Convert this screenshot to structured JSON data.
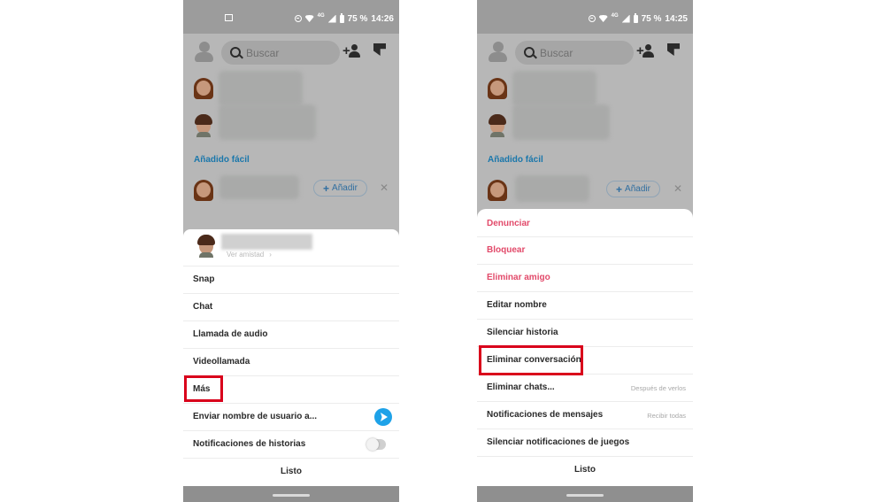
{
  "screens": [
    {
      "status_time": "14:26",
      "battery": "75 %",
      "network": "4G",
      "search_placeholder": "Buscar",
      "quick_add_title": "Añadido fácil",
      "quick_add_button": "Añadir",
      "sheet": {
        "ver_amistad": "Ver amistad",
        "items": [
          {
            "label": "Snap"
          },
          {
            "label": "Chat"
          },
          {
            "label": "Llamada de audio"
          },
          {
            "label": "Videollamada"
          },
          {
            "label": "Más"
          },
          {
            "label": "Enviar nombre de usuario a..."
          },
          {
            "label": "Notificaciones de historias"
          }
        ],
        "done": "Listo",
        "highlighted": "Más"
      }
    },
    {
      "status_time": "14:25",
      "battery": "75 %",
      "network": "4G",
      "search_placeholder": "Buscar",
      "quick_add_title": "Añadido fácil",
      "quick_add_button": "Añadir",
      "sheet": {
        "items": [
          {
            "label": "Denunciar",
            "color": "#e24a6a"
          },
          {
            "label": "Bloquear",
            "color": "#e24a6a"
          },
          {
            "label": "Eliminar amigo",
            "color": "#e24a6a"
          },
          {
            "label": "Editar nombre"
          },
          {
            "label": "Silenciar historia"
          },
          {
            "label": "Eliminar conversación"
          },
          {
            "label": "Eliminar chats...",
            "value": "Después de verlos"
          },
          {
            "label": "Notificaciones de mensajes",
            "value": "Recibir todas"
          },
          {
            "label": "Silenciar notificaciones de juegos"
          }
        ],
        "done": "Listo",
        "highlighted": "Eliminar conversación"
      }
    }
  ],
  "colors": {
    "destructive": "#e24a6a",
    "link": "#1a77ab",
    "highlight_box": "#d9001b",
    "send_button": "#1ea2e8"
  },
  "icons": [
    "image-icon",
    "dnd-icon",
    "wifi-icon",
    "signal-icon",
    "battery-icon",
    "profile-avatar-icon",
    "search-icon",
    "add-friend-icon",
    "new-chat-icon",
    "bitmoji-avatar",
    "close-icon",
    "chevron-right-icon",
    "send-icon",
    "toggle-switch"
  ]
}
